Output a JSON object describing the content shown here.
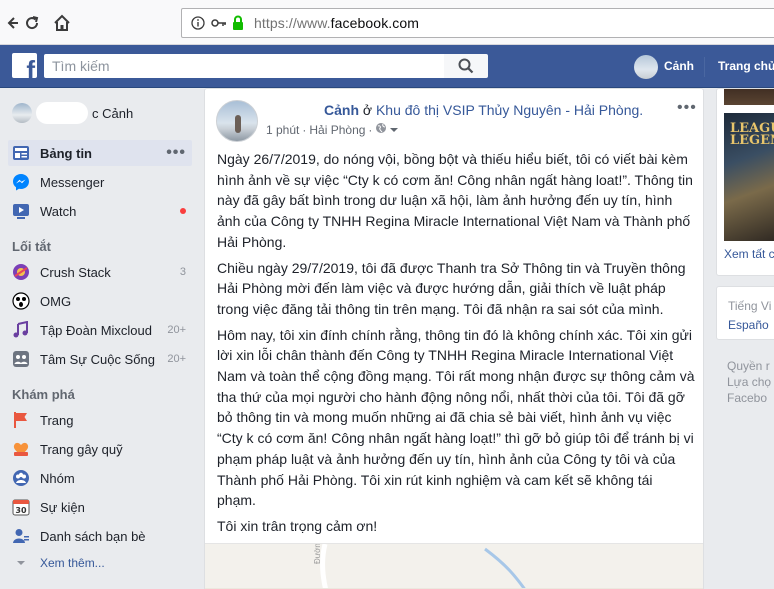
{
  "browser": {
    "url_scheme": "https://www.",
    "url_domain": "facebook.com"
  },
  "header": {
    "search_placeholder": "Tìm kiếm",
    "user_name": "Cảnh",
    "home_label": "Trang chủ"
  },
  "sidebar": {
    "profile_name": "c Cảnh",
    "items": [
      {
        "label": "Bảng tin",
        "icon": "news-feed-icon"
      },
      {
        "label": "Messenger",
        "icon": "messenger-icon"
      },
      {
        "label": "Watch",
        "icon": "watch-icon"
      }
    ],
    "shortcuts_heading": "Lối tắt",
    "shortcuts": [
      {
        "label": "Crush Stack",
        "count": "3"
      },
      {
        "label": "OMG",
        "count": ""
      },
      {
        "label": "Tập Đoàn Mixcloud",
        "count": "20+"
      },
      {
        "label": "Tâm Sự Cuộc Sống",
        "count": "20+"
      }
    ],
    "explore_heading": "Khám phá",
    "explore": [
      {
        "label": "Trang"
      },
      {
        "label": "Trang gây quỹ"
      },
      {
        "label": "Nhóm"
      },
      {
        "label": "Sự kiện",
        "icon_text": "30"
      },
      {
        "label": "Danh sách bạn bè"
      }
    ],
    "see_more": "Xem thêm..."
  },
  "post": {
    "author": "Cảnh",
    "location_prefix": "ở",
    "location": "Khu đô thị VSIP Thủy Nguyên - Hải Phòng.",
    "time": "1 phút",
    "city": "Hải Phòng",
    "paragraphs": [
      "Ngày 26/7/2019, do nóng vội, bồng bột và thiếu hiểu biết, tôi có viết bài kèm hình ảnh về sự việc “Cty k có cơm ăn! Công nhân ngất hàng loat!”. Thông tin này đã gây bất bình trong dư luận xã hội, làm ảnh hưởng đến uy tín, hình ảnh của Công ty TNHH Regina Miracle International Việt Nam và Thành phố Hải Phòng.",
      "Chiều ngày 29/7/2019, tôi đã được Thanh tra Sở Thông tin và Truyền thông Hải Phòng mời đến làm việc và được hướng dẫn, giải thích về luật pháp trong việc đăng tải thông tin trên mạng. Tôi đã nhận ra sai sót của mình.",
      "Hôm nay, tôi xin đính chính rằng, thông tin đó là không chính xác. Tôi xin gửi lời xin lỗi chân thành đến Công ty TNHH Regina Miracle International Việt Nam và toàn thể cộng đồng mạng. Tôi rất mong nhận được sự thông cảm và tha thứ của mọi người cho hành động nông nổi, nhất thời của tôi. Tôi đã gỡ bỏ thông tin và mong muốn những ai đã chia sẻ bài viết, hình ảnh vụ việc “Cty k có cơm ăn! Công nhân ngất hàng loạt!” thì gỡ bỏ giúp tôi để tránh bị vi phạm pháp luật và ảnh hưởng đến uy tín, hình ảnh của Công ty tôi và của Thành phố Hải Phòng. Tôi xin rút kinh nghiệm và cam kết sẽ không tái phạm.",
      "Tôi xin trân trọng cảm ơn!"
    ],
    "map_label": "Đường Mần"
  },
  "right": {
    "game_title": "LEAGUE LEGENDS",
    "see_all": "Xem tất c",
    "lang_current": "Tiếng Vi",
    "lang_other": "Españo",
    "footer_lines": [
      "Quyền r",
      "Lựa chọ",
      "Facebo"
    ]
  },
  "colors": {
    "fb_blue": "#3b5998",
    "link": "#365899",
    "notification_red": "#fa3e3e"
  }
}
